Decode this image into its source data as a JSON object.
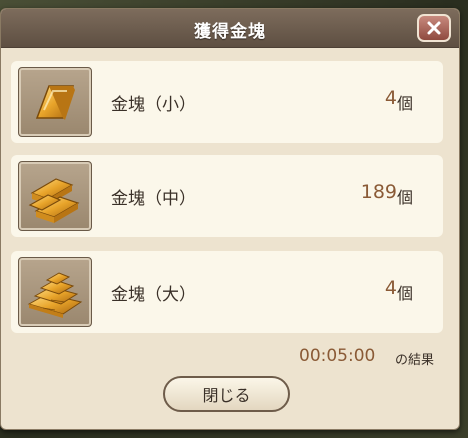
{
  "dialog": {
    "title": "獲得金塊",
    "close_icon": "close-x-icon"
  },
  "items": [
    {
      "name": "金塊（小）",
      "count": "4",
      "unit": "個",
      "icon": "gold-bar-small-icon"
    },
    {
      "name": "金塊（中）",
      "count": "189",
      "unit": "個",
      "icon": "gold-bar-medium-icon"
    },
    {
      "name": "金塊（大）",
      "count": "4",
      "unit": "個",
      "icon": "gold-bar-large-icon"
    }
  ],
  "result": {
    "time": "00:05:00",
    "suffix": "の結果"
  },
  "footer": {
    "close_label": "閉じる"
  },
  "colors": {
    "titlebar": "#6e5e50",
    "panel": "#ede3cf",
    "card": "#fbf7ea",
    "count": "#8a5a36",
    "gold": "#e8a42a"
  }
}
